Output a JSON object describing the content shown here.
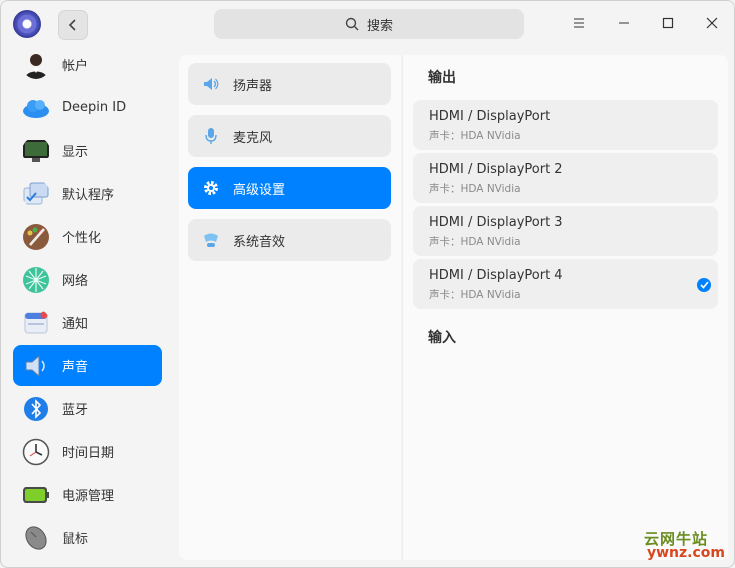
{
  "titlebar": {
    "search_placeholder": "搜索",
    "back_icon": "chevron-left-icon",
    "menu_icon": "menu-icon",
    "minimize_icon": "minimize-icon",
    "maximize_icon": "maximize-icon",
    "close_icon": "close-icon"
  },
  "sidebar": {
    "active_index": 7,
    "items": [
      {
        "label": "帐户",
        "icon": "account-icon"
      },
      {
        "label": "Deepin ID",
        "icon": "cloud-icon"
      },
      {
        "label": "显示",
        "icon": "display-icon"
      },
      {
        "label": "默认程序",
        "icon": "default-apps-icon"
      },
      {
        "label": "个性化",
        "icon": "personalization-icon"
      },
      {
        "label": "网络",
        "icon": "network-icon"
      },
      {
        "label": "通知",
        "icon": "notification-icon"
      },
      {
        "label": "声音",
        "icon": "sound-icon"
      },
      {
        "label": "蓝牙",
        "icon": "bluetooth-icon"
      },
      {
        "label": "时间日期",
        "icon": "clock-icon"
      },
      {
        "label": "电源管理",
        "icon": "battery-icon"
      },
      {
        "label": "鼠标",
        "icon": "mouse-icon"
      }
    ]
  },
  "sound_menu": {
    "active_index": 2,
    "items": [
      {
        "label": "扬声器",
        "icon": "speaker-icon"
      },
      {
        "label": "麦克风",
        "icon": "microphone-icon"
      },
      {
        "label": "高级设置",
        "icon": "gear-icon"
      },
      {
        "label": "系统音效",
        "icon": "sound-effects-icon"
      }
    ]
  },
  "output": {
    "title": "输出",
    "devices": [
      {
        "name": "HDMI / DisplayPort",
        "card": "声卡：HDA NVidia",
        "selected": false
      },
      {
        "name": "HDMI / DisplayPort 2",
        "card": "声卡：HDA NVidia",
        "selected": false
      },
      {
        "name": "HDMI / DisplayPort 3",
        "card": "声卡：HDA NVidia",
        "selected": false
      },
      {
        "name": "HDMI / DisplayPort 4",
        "card": "声卡：HDA NVidia",
        "selected": true
      }
    ]
  },
  "input": {
    "title": "输入"
  },
  "watermark": {
    "cn": "云网牛站",
    "en": "ywnz.com"
  },
  "colors": {
    "accent": "#0081ff",
    "window_bg": "#f4f4f4",
    "panel_bg": "#fafafa",
    "item_bg": "#ebebeb"
  }
}
